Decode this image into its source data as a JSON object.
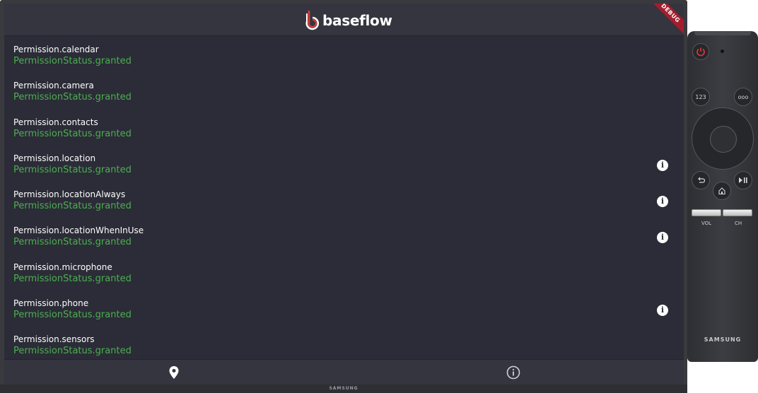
{
  "app": {
    "brand": "baseflow",
    "debug_banner": "DEBUG"
  },
  "permissions": [
    {
      "name": "Permission.calendar",
      "status": "PermissionStatus.granted",
      "has_info": false
    },
    {
      "name": "Permission.camera",
      "status": "PermissionStatus.granted",
      "has_info": false
    },
    {
      "name": "Permission.contacts",
      "status": "PermissionStatus.granted",
      "has_info": false
    },
    {
      "name": "Permission.location",
      "status": "PermissionStatus.granted",
      "has_info": true
    },
    {
      "name": "Permission.locationAlways",
      "status": "PermissionStatus.granted",
      "has_info": true
    },
    {
      "name": "Permission.locationWhenInUse",
      "status": "PermissionStatus.granted",
      "has_info": true
    },
    {
      "name": "Permission.microphone",
      "status": "PermissionStatus.granted",
      "has_info": false
    },
    {
      "name": "Permission.phone",
      "status": "PermissionStatus.granted",
      "has_info": true
    },
    {
      "name": "Permission.sensors",
      "status": "PermissionStatus.granted",
      "has_info": false
    }
  ],
  "bottom_nav": {
    "items": [
      {
        "icon": "location-pin-icon"
      },
      {
        "icon": "info-icon"
      }
    ]
  },
  "device": {
    "tv_brand": "SAMSUNG",
    "remote_brand": "SAMSUNG",
    "remote_num_label": "123",
    "remote_more_label": "ooo",
    "remote_vol_label": "VOL",
    "remote_ch_label": "CH"
  },
  "colors": {
    "background": "#2b2c37",
    "appbar": "#34353f",
    "status_granted": "#4caf50",
    "debug_banner": "#a51d2d",
    "logo_accent": "#e53935"
  }
}
